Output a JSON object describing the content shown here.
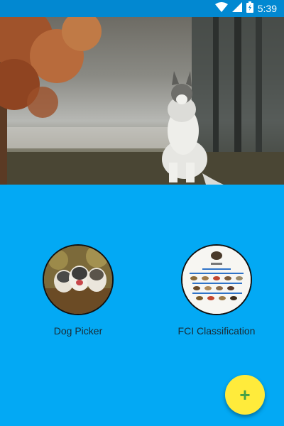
{
  "status_bar": {
    "time": "5:39",
    "icons": [
      "wifi-icon",
      "signal-icon",
      "battery-icon"
    ]
  },
  "header_image": {
    "subject": "siberian-husky-photo"
  },
  "cards": [
    {
      "label": "Dog Picker",
      "image": "huskies-photo"
    },
    {
      "label": "FCI Classification",
      "image": "fci-classification-chart"
    }
  ],
  "fab": {
    "icon": "plus-icon",
    "symbol": "+"
  },
  "colors": {
    "status_bar": "#0288D1",
    "background": "#03A9F4",
    "fab": "#FFEB3B",
    "fab_icon": "#43A047"
  }
}
